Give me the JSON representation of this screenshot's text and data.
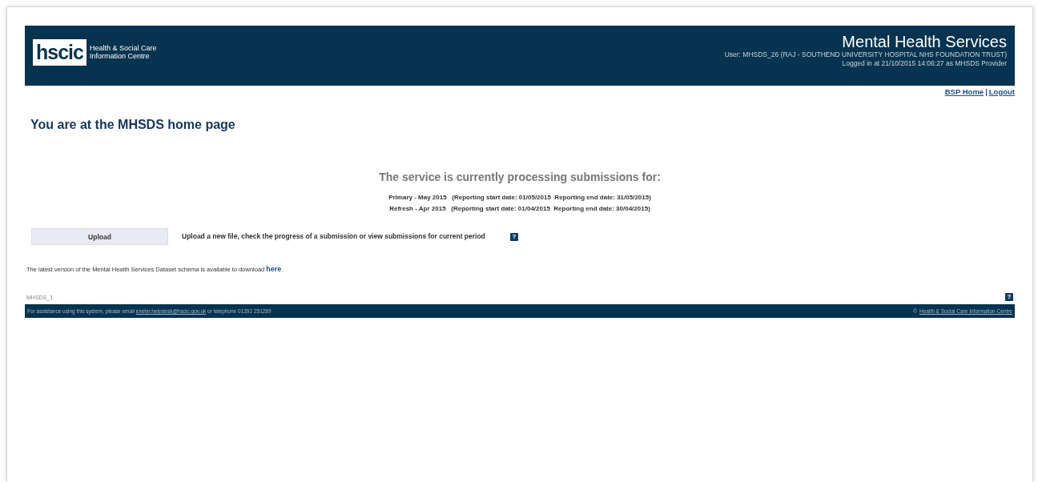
{
  "header": {
    "logo": {
      "mark": "hscic",
      "lines": [
        "Health & Social Care",
        "Information Centre"
      ]
    },
    "title": "Mental Health Services",
    "user_line": "User: MHSDS_26  (RAJ - SOUTHEND UNIVERSITY HOSPITAL NHS FOUNDATION TRUST)",
    "login_line": "Logged in at 21/10/2015 14:06:27  as MHSDS Provider"
  },
  "nav_links": [
    {
      "label": "BSP Home"
    },
    {
      "label": "Logout"
    }
  ],
  "nav_separator": "|",
  "page_heading": "You are at the MHSDS home page",
  "processing": {
    "heading": "The service is currently processing submissions for:",
    "periods": [
      "Primary - May 2015   (Reporting start date: 01/05/2015  Reporting end date: 31/05/2015)",
      "Refresh - Apr 2015   (Reporting start date: 01/04/2015  Reporting end date: 30/04/2015)"
    ]
  },
  "actions": [
    {
      "button": "Upload",
      "description": "Upload a new file, check the progress of a submission or view submissions for current period",
      "help": "?"
    }
  ],
  "schema_note": {
    "text": "The latest version of the Mental Health Services Dataset schema is available to download ",
    "link": "here",
    "after": "."
  },
  "page_id": "MHSDS_1",
  "page_help": "?",
  "footer": {
    "text_before": "For assistance using this system, please email ",
    "email": "exeter.helpdesk@hscic.gov.uk",
    "text_after": " or telephone 01392 251289",
    "copyright_symbol": "©",
    "copyright_link": "Health & Social Care Information Centre"
  }
}
